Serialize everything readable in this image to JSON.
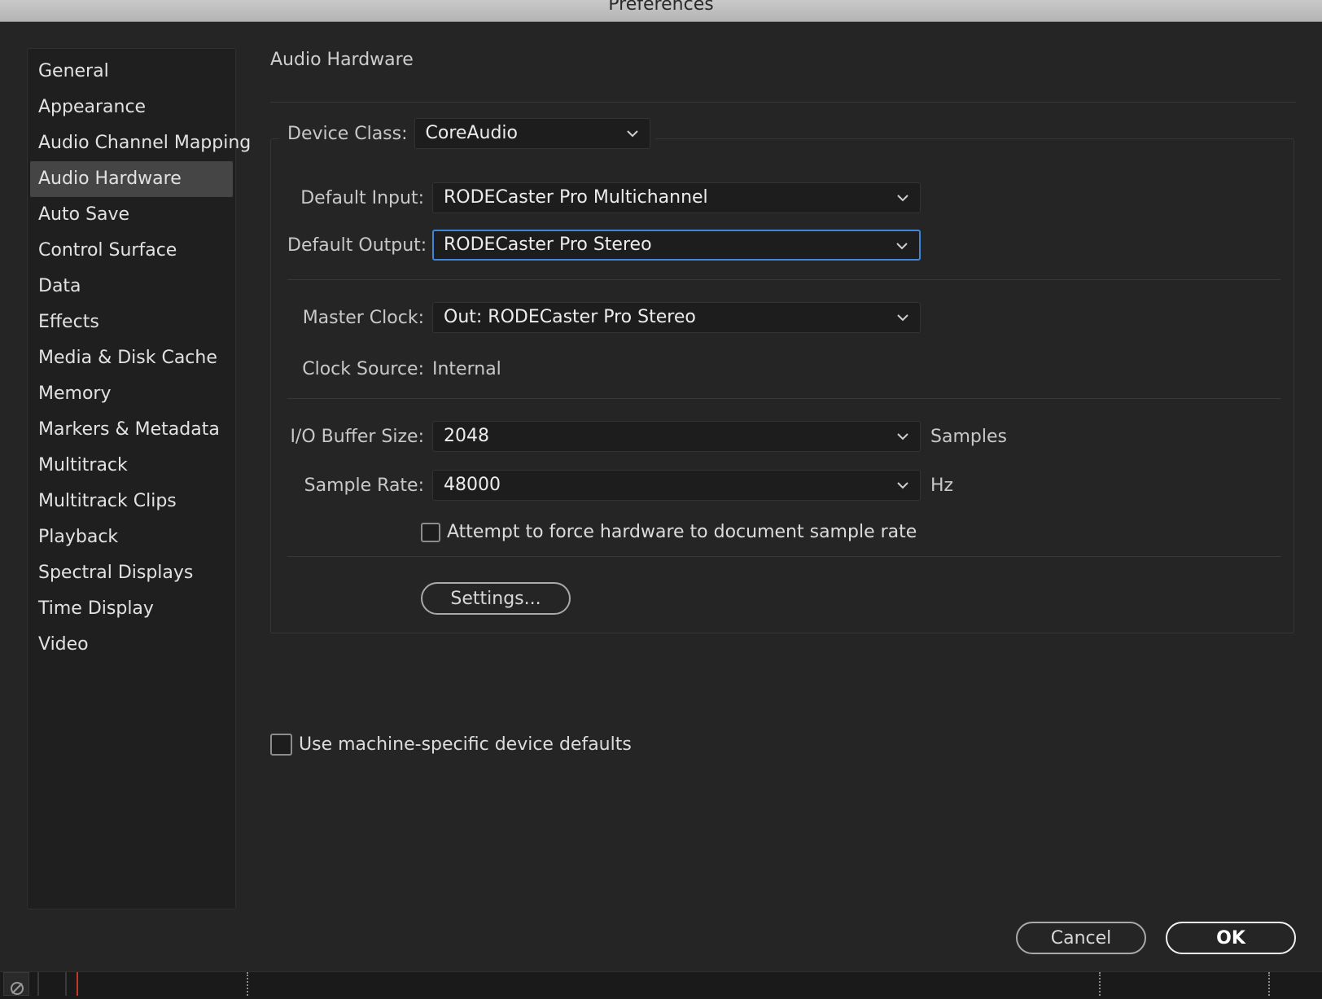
{
  "window": {
    "title": "Preferences"
  },
  "sidebar": {
    "items": [
      {
        "label": "General"
      },
      {
        "label": "Appearance"
      },
      {
        "label": "Audio Channel Mapping"
      },
      {
        "label": "Audio Hardware",
        "selected": true
      },
      {
        "label": "Auto Save"
      },
      {
        "label": "Control Surface"
      },
      {
        "label": "Data"
      },
      {
        "label": "Effects"
      },
      {
        "label": "Media & Disk Cache"
      },
      {
        "label": "Memory"
      },
      {
        "label": "Markers & Metadata"
      },
      {
        "label": "Multitrack"
      },
      {
        "label": "Multitrack Clips"
      },
      {
        "label": "Playback"
      },
      {
        "label": "Spectral Displays"
      },
      {
        "label": "Time Display"
      },
      {
        "label": "Video"
      }
    ]
  },
  "main": {
    "section_title": "Audio Hardware",
    "device_class": {
      "label": "Device Class:",
      "value": "CoreAudio"
    },
    "default_input": {
      "label": "Default Input:",
      "value": "RODECaster Pro Multichannel"
    },
    "default_output": {
      "label": "Default Output:",
      "value": "RODECaster Pro Stereo"
    },
    "master_clock": {
      "label": "Master Clock:",
      "value": "Out: RODECaster Pro Stereo"
    },
    "clock_source": {
      "label": "Clock Source:",
      "value": "Internal"
    },
    "io_buffer": {
      "label": "I/O Buffer Size:",
      "value": "2048",
      "unit": "Samples"
    },
    "sample_rate": {
      "label": "Sample Rate:",
      "value": "48000",
      "unit": "Hz"
    },
    "force_rate": {
      "label": "Attempt to force hardware to document sample rate",
      "checked": false
    },
    "settings_button": "Settings...",
    "machine_defaults": {
      "label": "Use machine-specific device defaults",
      "checked": false
    }
  },
  "footer": {
    "cancel_label": "Cancel",
    "ok_label": "OK"
  },
  "colors": {
    "focus_ring": "#3f86d8",
    "selected_item": "#454545",
    "timeline_marker": "#c0392b"
  },
  "icons": {
    "dropdown": "chevron-down-icon",
    "strip_left": "no-entry-icon"
  }
}
